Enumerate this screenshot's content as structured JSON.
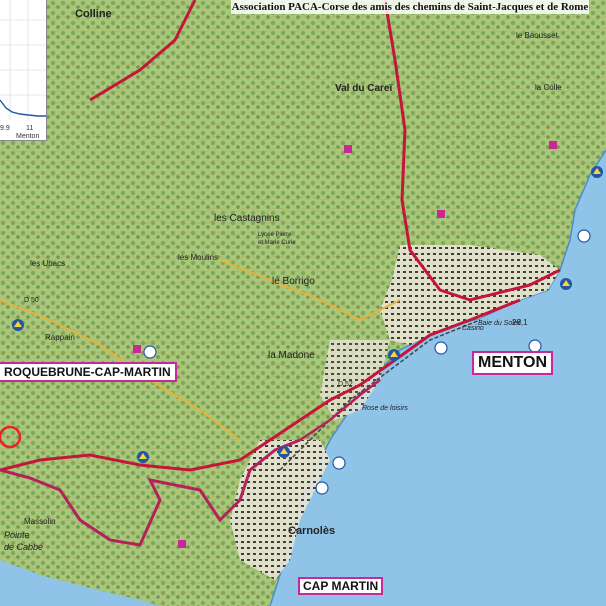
{
  "header": {
    "title": "Association PACA-Corse des amis des chemins de Saint-Jacques et de Rome"
  },
  "profile": {
    "ticks": [
      "9.9",
      "11"
    ],
    "end_label": "Menton"
  },
  "towns": {
    "menton": "MENTON",
    "roquebrune": "ROQUEBRUNE-CAP-MARTIN",
    "cap_martin": "CAP MARTIN"
  },
  "places": {
    "colline": "Colline",
    "val_du_carei": "Val du Careï",
    "les_castagnins": "les Castagnins",
    "le_borrigo": "le Borrigo",
    "la_madone": "la Madone",
    "carnoles": "Carnolès",
    "les_moulins": "les Moulins",
    "rappain": "Rappain",
    "les_ubacs": "les Ubacs",
    "baousset": "le Baousset",
    "la_colle": "la Colle",
    "pointe_cabbe": "Pointe",
    "pointe_cabbe2": "de Cabbé",
    "massolin": "Massolin",
    "lycee": "Lycée Pierre",
    "lycee2": "et Marie Curie",
    "baie_soleil": "Baie du Soleil",
    "rose_loisirs": "Rose de loisirs",
    "casino": "Casino",
    "depth": "28,1",
    "d50": "D 50",
    "d52": "D 52"
  },
  "colors": {
    "land": "#d7e3a8",
    "forest": "#7ea85a",
    "sea": "#8fc3e8",
    "road": "#c4163a",
    "route": "#b5215a",
    "marker": "#c9279a",
    "pilgrim": "#1f56a8"
  },
  "icons": [
    "scallop-shell-icon",
    "sailboat-icon",
    "church-icon",
    "elevation-profile"
  ]
}
